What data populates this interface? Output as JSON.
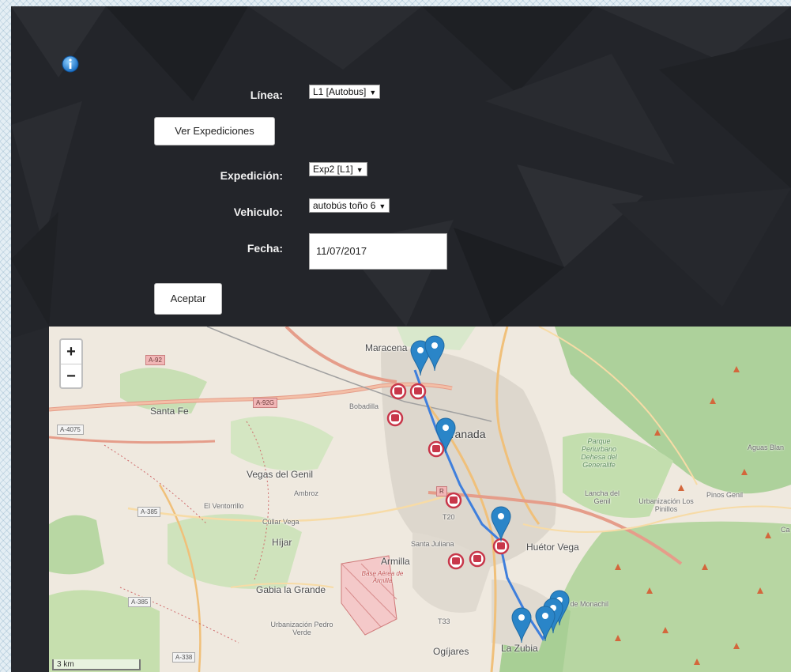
{
  "form": {
    "linea_label": "Línea:",
    "linea_value": "L1 [Autobus]",
    "ver_expediciones": "Ver Expediciones",
    "expedicion_label": "Expedición:",
    "expedicion_value": "Exp2 [L1]",
    "vehiculo_label": "Vehiculo:",
    "vehiculo_value": "autobús toño 6",
    "fecha_label": "Fecha:",
    "fecha_value": "11/07/2017",
    "aceptar": "Aceptar"
  },
  "map": {
    "zoom_in": "+",
    "zoom_out": "−",
    "scale": "3 km",
    "labels": {
      "maracena": "Maracena",
      "granada": "Granada",
      "santa_fe": "Santa Fe",
      "bobadilla": "Bobadilla",
      "vegas_del_genil": "Vegas del Genil",
      "ambroz": "Ambroz",
      "el_ventorrillo": "El Ventorrillo",
      "cullar_vega": "Cúllar Vega",
      "hijar": "Híjar",
      "santa_juliana": "Santa Juliana",
      "armilla": "Armilla",
      "base_aerea": "Base Aérea de Armilla",
      "gabia": "Gabia la Grande",
      "urb_pedro_verde": "Urbanización Pedro Verde",
      "ogijares": "Ogíjares",
      "la_zubia": "La Zubia",
      "huetor_vega": "Huétor Vega",
      "monachil": "o de Monachil",
      "lancha_del_genil": "Lancha del Genil",
      "urb_los_pinillos": "Urbanización Los Pinillos",
      "pinos_genil": "Pinos Genil",
      "aguas_blancas": "Aguas Blan",
      "parque_periurbano": "Parque Periurbano Dehesa del Generalife",
      "ca": "Ca"
    },
    "roads": {
      "a92": "A-92",
      "a92g": "A-92G",
      "a4075": "A-4075",
      "a385_1": "A-385",
      "a385_2": "A-385",
      "a338": "A-338",
      "r": "R",
      "t20": "T20",
      "t33": "T33"
    },
    "route_color": "#3f7fdc",
    "stop_color": "#c8374a",
    "marker_color": "#2a85c8",
    "route_icon": "bus-stop-icon"
  }
}
